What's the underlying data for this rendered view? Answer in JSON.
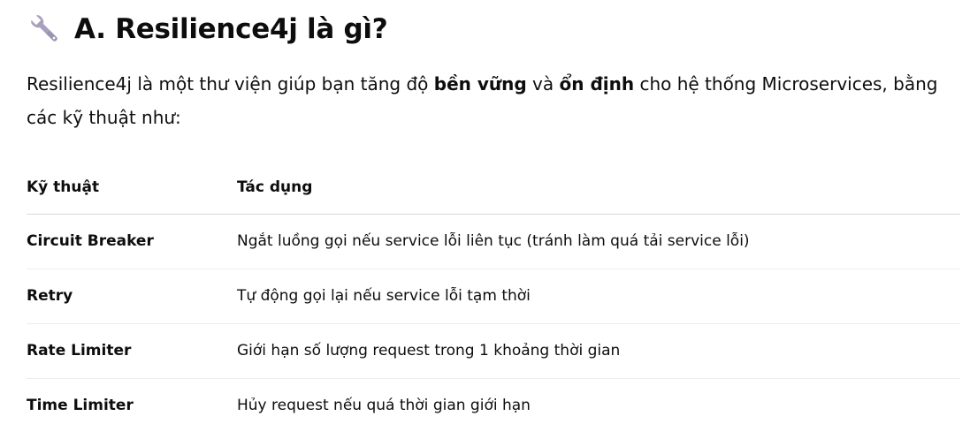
{
  "section": {
    "icon": "wrench-icon",
    "title": "A. Resilience4j là gì?"
  },
  "intro": {
    "part1": "Resilience4j là một thư viện giúp bạn tăng độ ",
    "bold1": "bền vững",
    "part2": " và ",
    "bold2": "ổn định",
    "part3": " cho hệ thống Microservices, bằng các kỹ thuật như:"
  },
  "table": {
    "headers": [
      "Kỹ thuật",
      "Tác dụng"
    ],
    "rows": [
      [
        "Circuit Breaker",
        "Ngắt luồng gọi nếu service lỗi liên tục (tránh làm quá tải service lỗi)"
      ],
      [
        "Retry",
        "Tự động gọi lại nếu service lỗi tạm thời"
      ],
      [
        "Rate Limiter",
        "Giới hạn số lượng request trong 1 khoảng thời gian"
      ],
      [
        "Time Limiter",
        "Hủy request nếu quá thời gian giới hạn"
      ]
    ]
  },
  "colors": {
    "text": "#0d0d0d",
    "icon": "#9b93b0",
    "divider": "#d9d9d9"
  }
}
